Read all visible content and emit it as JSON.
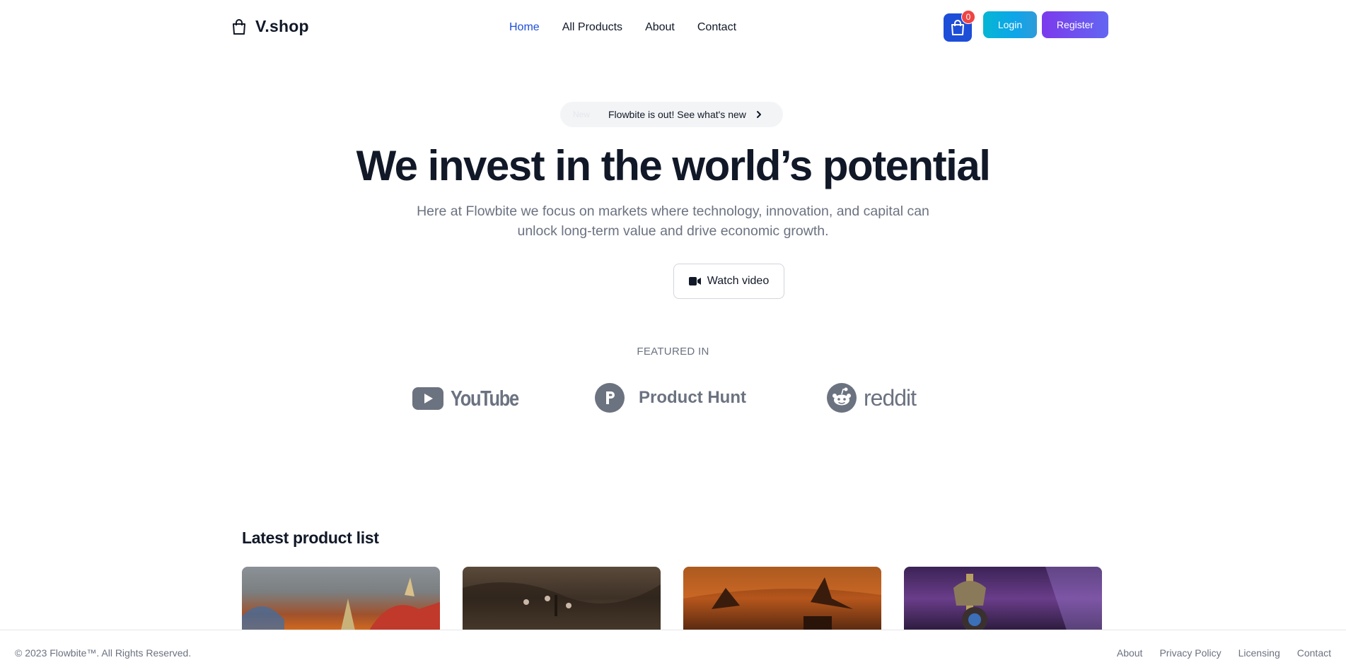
{
  "navbar": {
    "brand": "V.shop",
    "links": [
      "Home",
      "All Products",
      "About",
      "Contact"
    ],
    "active_link": "Home",
    "cart_count": "0",
    "login_label": "Login",
    "register_label": "Register"
  },
  "hero": {
    "announce_pill": "New",
    "announce_text": "Flowbite is out! See what's new",
    "title": "We invest in the world’s potential",
    "subtitle": "Here at Flowbite we focus on markets where technology, innovation, and capital can unlock long-term value and drive economic growth.",
    "watch_label": "Watch video"
  },
  "featured": {
    "label": "FEATURED IN",
    "logos": [
      "YouTube",
      "Product Hunt",
      "reddit"
    ]
  },
  "products": {
    "title": "Latest product list"
  },
  "footer": {
    "copyright": "© 2023 Flowbite™. All Rights Reserved.",
    "links": [
      "About",
      "Privacy Policy",
      "Licensing",
      "Contact"
    ]
  },
  "colors": {
    "accent": "#1d4ed8",
    "cart_badge": "#ef4444",
    "login_gradient": "#06b6d4",
    "register_gradient": "#7c3aed",
    "muted_text": "#6b7280"
  }
}
